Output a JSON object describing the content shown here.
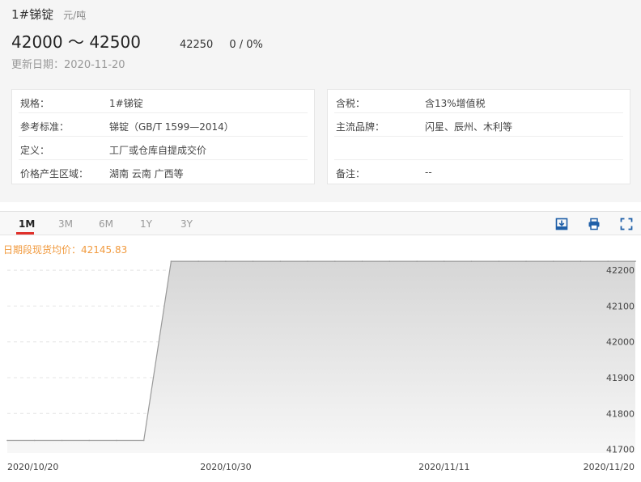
{
  "product": {
    "title": "1#锑锭",
    "unit": "元/吨",
    "price_range": "42000 ～ 42500",
    "average": "42250",
    "change": "0 / 0%",
    "update_label": "更新日期：2020-11-20"
  },
  "specs_left": [
    {
      "label": "规格：",
      "value": "1#锑锭"
    },
    {
      "label": "参考标准：",
      "value": "锑锭（GB/T 1599—2014）"
    },
    {
      "label": "定义：",
      "value": "工厂或仓库自提成交价"
    },
    {
      "label": "价格产生区域：",
      "value": "湖南 云南 广西等"
    }
  ],
  "specs_right": [
    {
      "label": "含税：",
      "value": "含13%增值税"
    },
    {
      "label": "主流品牌：",
      "value": "闪星、辰州、木利等"
    },
    {
      "label": "",
      "value": ""
    },
    {
      "label": "备注：",
      "value": "--"
    }
  ],
  "tabs": [
    {
      "label": "1M",
      "active": true
    },
    {
      "label": "3M",
      "active": false
    },
    {
      "label": "6M",
      "active": false
    },
    {
      "label": "1Y",
      "active": false
    },
    {
      "label": "3Y",
      "active": false
    }
  ],
  "toolbar": {
    "icons": [
      "download-icon",
      "print-icon",
      "fullscreen-icon"
    ],
    "color": "#1f5fa8"
  },
  "chart_data": {
    "type": "area",
    "legend": "日期段现货均价：42145.83",
    "x": [
      "2020-10-20",
      "2020-10-21",
      "2020-10-22",
      "2020-10-23",
      "2020-10-26",
      "2020-10-27",
      "2020-10-28",
      "2020-10-29",
      "2020-10-30",
      "2020-11-02",
      "2020-11-03",
      "2020-11-04",
      "2020-11-05",
      "2020-11-06",
      "2020-11-09",
      "2020-11-10",
      "2020-11-11",
      "2020-11-12",
      "2020-11-13",
      "2020-11-16",
      "2020-11-17",
      "2020-11-18",
      "2020-11-19",
      "2020-11-20"
    ],
    "values": [
      41725,
      41725,
      41725,
      41725,
      41725,
      41725,
      42225,
      42225,
      42225,
      42225,
      42225,
      42225,
      42225,
      42225,
      42225,
      42225,
      42225,
      42225,
      42225,
      42225,
      42225,
      42225,
      42225,
      42225
    ],
    "x_tick_labels": [
      "2020/10/20",
      "2020/10/30",
      "2020/11/11",
      "2020/11/20"
    ],
    "x_tick_values": [
      "2020-10-20",
      "2020-10-30",
      "2020-11-11",
      "2020-11-20"
    ],
    "y_ticks": [
      41700,
      41800,
      41900,
      42000,
      42100,
      42200
    ],
    "ylim": [
      41690,
      42250
    ],
    "line_color": "#999999",
    "accent_color": "#f19a3e"
  }
}
